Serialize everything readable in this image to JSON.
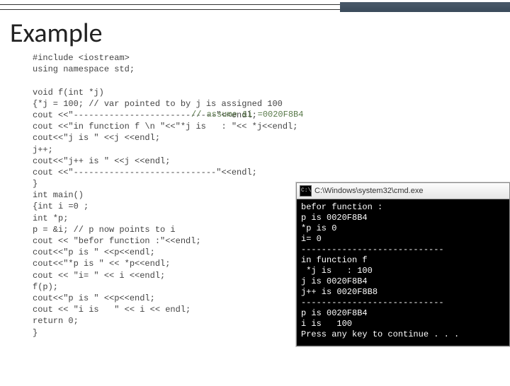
{
  "title": "Example",
  "assume_comment": "// assume &i =0020F8B4",
  "code": "#include <iostream>\nusing namespace std;\n\nvoid f(int *j)\n{*j = 100; // var pointed to by j is assigned 100\ncout <<\"----------------------------\"<<endl;\ncout <<\"in function f \\n \"<<\"*j is   : \"<< *j<<endl;\ncout<<\"j is \" <<j <<endl;\nj++;\ncout<<\"j++ is \" <<j <<endl;\ncout <<\"----------------------------\"<<endl;\n}\nint main()\n{int i =0 ;\nint *p;\np = &i; // p now points to i\ncout << \"befor function :\"<<endl;\ncout<<\"p is \" <<p<<endl;\ncout<<\"*p is \" << *p<<endl;\ncout << \"i= \" << i <<endl;\nf(p);\ncout<<\"p is \" <<p<<endl;\ncout << \"i is   \" << i << endl;\nreturn 0;\n}",
  "console": {
    "title": "C:\\Windows\\system32\\cmd.exe",
    "icon_label": "C:\\",
    "output": "befor function :\np is 0020F8B4\n*p is 0\ni= 0\n----------------------------\nin function f\n *j is   : 100\nj is 0020F8B4\nj++ is 0020F8B8\n----------------------------\np is 0020F8B4\ni is   100\nPress any key to continue . . ."
  }
}
